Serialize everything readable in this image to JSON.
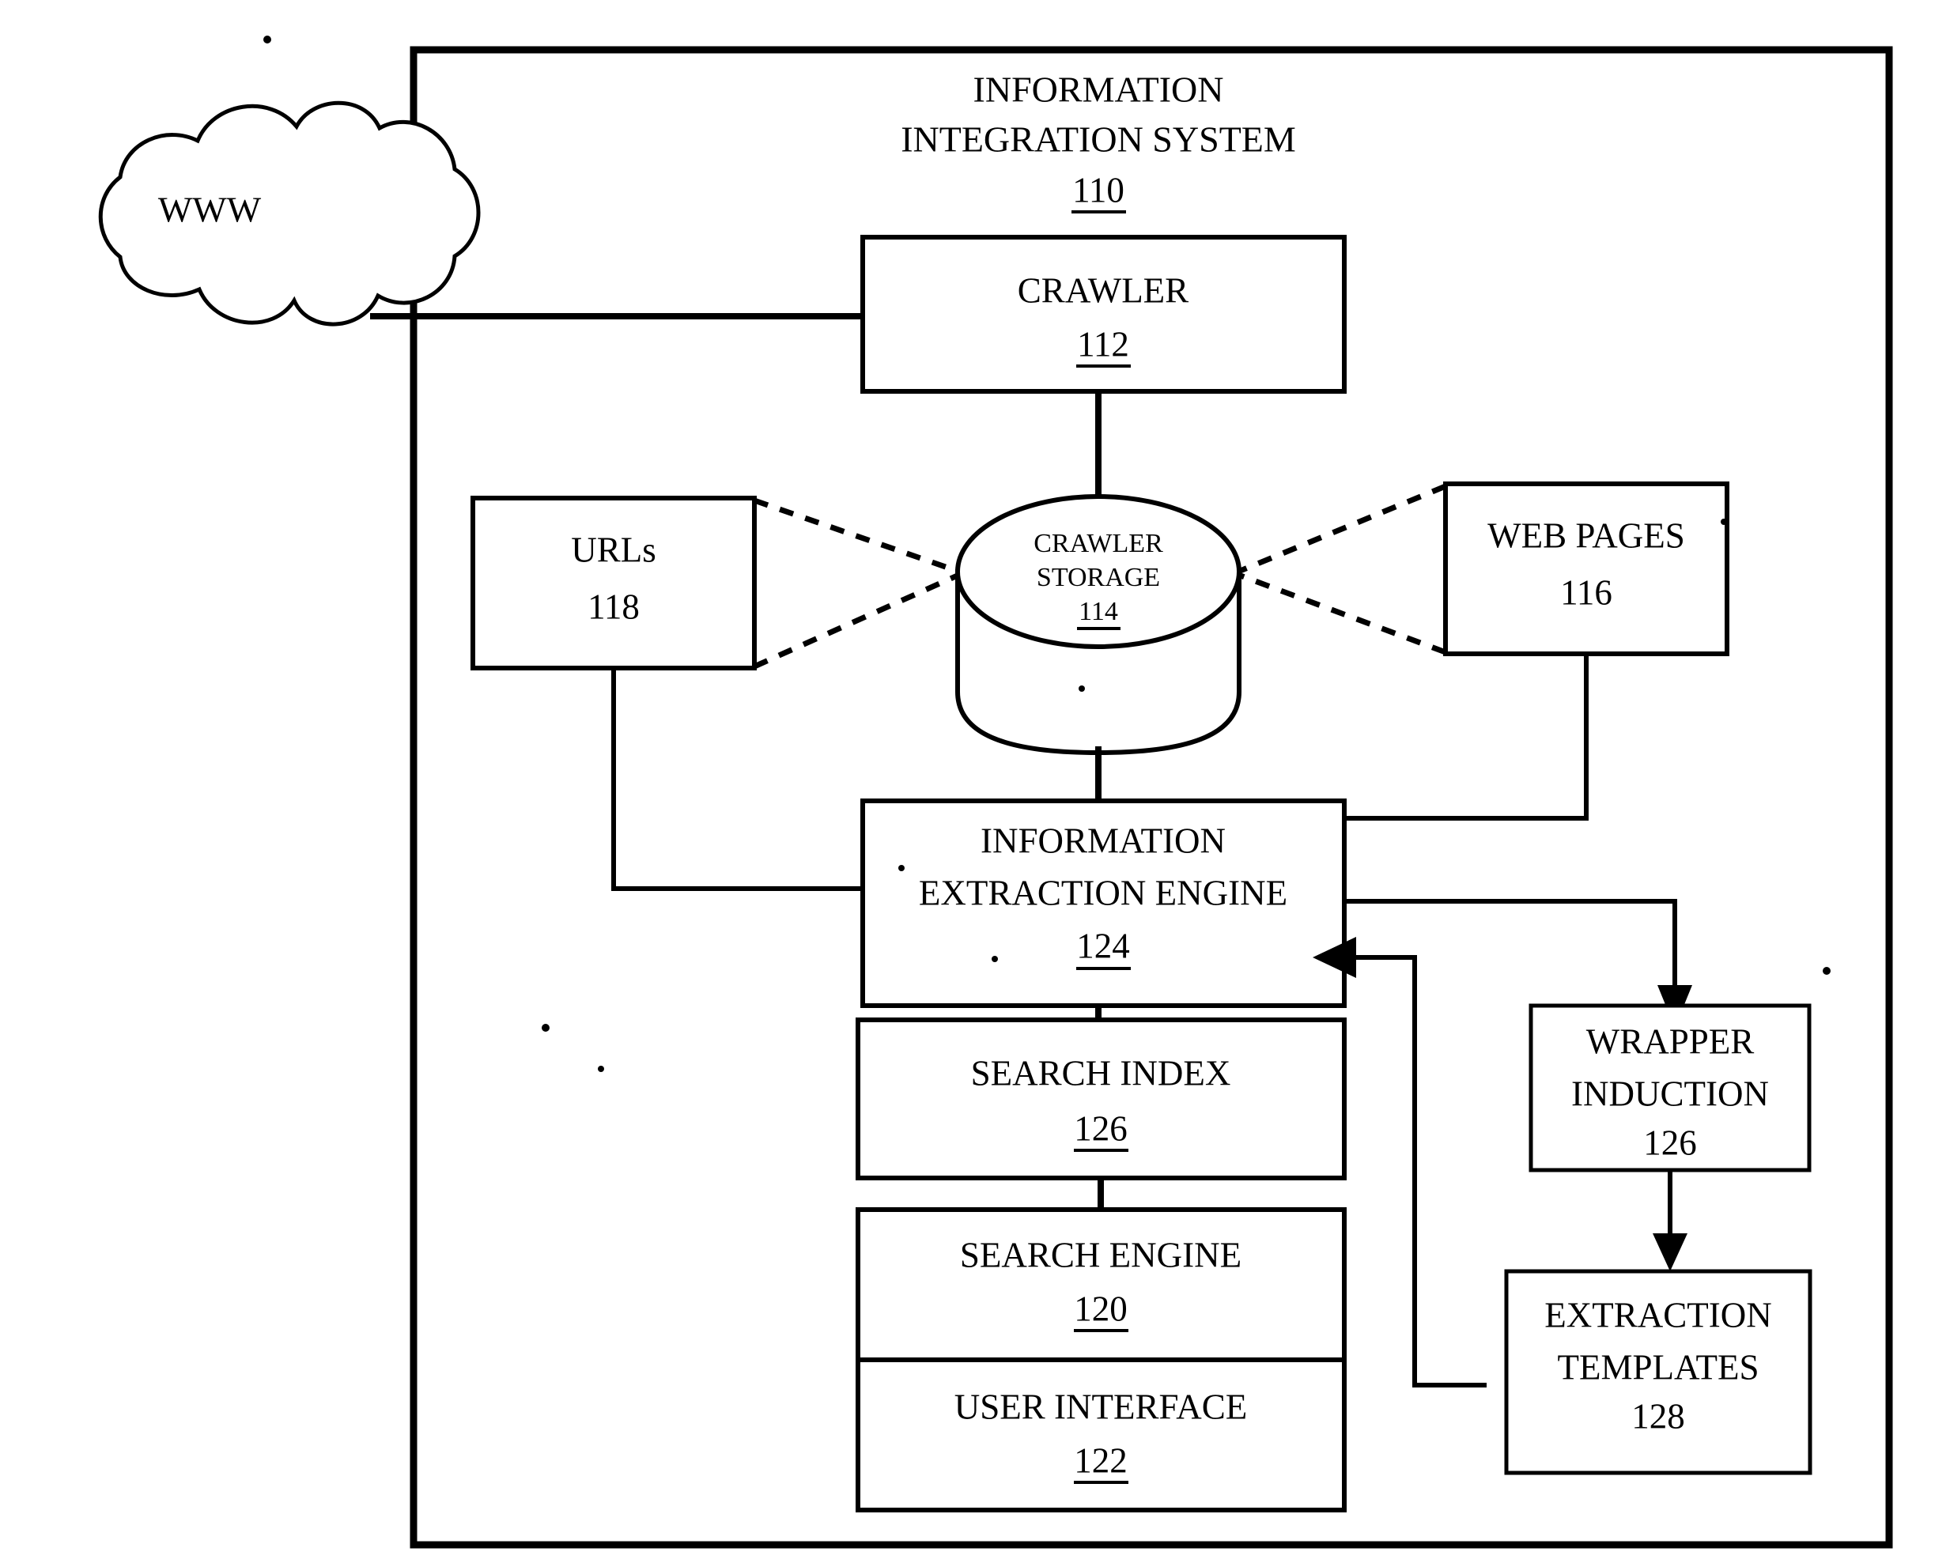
{
  "figure": {
    "type": "patent-block-diagram",
    "system_title_line1": "INFORMATION",
    "system_title_line2": "INTEGRATION SYSTEM",
    "system_ref": "110",
    "external_network": {
      "label": "WWW",
      "shape": "cloud-icon"
    },
    "nodes": [
      {
        "id": "crawler",
        "label_lines": [
          "CRAWLER"
        ],
        "ref": "112",
        "ref_underlined": true,
        "shape": "rectangle"
      },
      {
        "id": "crawler-storage",
        "label_lines": [
          "CRAWLER",
          "STORAGE"
        ],
        "ref": "114",
        "ref_underlined": true,
        "shape": "cylinder"
      },
      {
        "id": "urls",
        "label_lines": [
          "URLs"
        ],
        "ref": "118",
        "ref_underlined": false,
        "shape": "rectangle"
      },
      {
        "id": "web-pages",
        "label_lines": [
          "WEB PAGES"
        ],
        "ref": "116",
        "ref_underlined": false,
        "shape": "rectangle"
      },
      {
        "id": "information-extraction-engine",
        "label_lines": [
          "INFORMATION",
          "EXTRACTION ENGINE"
        ],
        "ref": "124",
        "ref_underlined": true,
        "shape": "rectangle"
      },
      {
        "id": "search-index",
        "label_lines": [
          "SEARCH INDEX"
        ],
        "ref": "126",
        "ref_underlined": true,
        "shape": "rectangle"
      },
      {
        "id": "search-engine",
        "label_lines": [
          "SEARCH ENGINE"
        ],
        "ref": "120",
        "ref_underlined": true,
        "shape": "rectangle"
      },
      {
        "id": "user-interface",
        "label_lines": [
          "USER INTERFACE"
        ],
        "ref": "122",
        "ref_underlined": true,
        "shape": "rectangle"
      },
      {
        "id": "wrapper-induction",
        "label_lines": [
          "WRAPPER",
          "INDUCTION"
        ],
        "ref": "126",
        "ref_underlined": false,
        "shape": "rectangle"
      },
      {
        "id": "extraction-templates",
        "label_lines": [
          "EXTRACTION",
          "TEMPLATES"
        ],
        "ref": "128",
        "ref_underlined": false,
        "shape": "rectangle"
      }
    ],
    "edges": [
      {
        "from": "www",
        "to": "crawler",
        "style": "solid",
        "arrow": false
      },
      {
        "from": "crawler",
        "to": "crawler-storage",
        "style": "solid",
        "arrow": false
      },
      {
        "from": "urls",
        "to": "crawler-storage",
        "style": "dashed",
        "arrow": false
      },
      {
        "from": "web-pages",
        "to": "crawler-storage",
        "style": "dashed",
        "arrow": false
      },
      {
        "from": "crawler-storage",
        "to": "information-extraction-engine",
        "style": "solid",
        "arrow": false
      },
      {
        "from": "urls",
        "to": "information-extraction-engine",
        "style": "solid",
        "arrow": false
      },
      {
        "from": "web-pages",
        "to": "information-extraction-engine",
        "style": "solid",
        "arrow": false
      },
      {
        "from": "information-extraction-engine",
        "to": "search-index",
        "style": "solid",
        "arrow": false
      },
      {
        "from": "search-index",
        "to": "search-engine",
        "style": "solid",
        "arrow": false
      },
      {
        "from": "information-extraction-engine",
        "to": "wrapper-induction",
        "style": "solid",
        "arrow": true
      },
      {
        "from": "wrapper-induction",
        "to": "extraction-templates",
        "style": "solid",
        "arrow": true
      },
      {
        "from": "extraction-templates",
        "to": "information-extraction-engine",
        "style": "solid",
        "arrow": true
      }
    ],
    "colors": {
      "ink": "#000000",
      "paper": "#ffffff"
    }
  }
}
